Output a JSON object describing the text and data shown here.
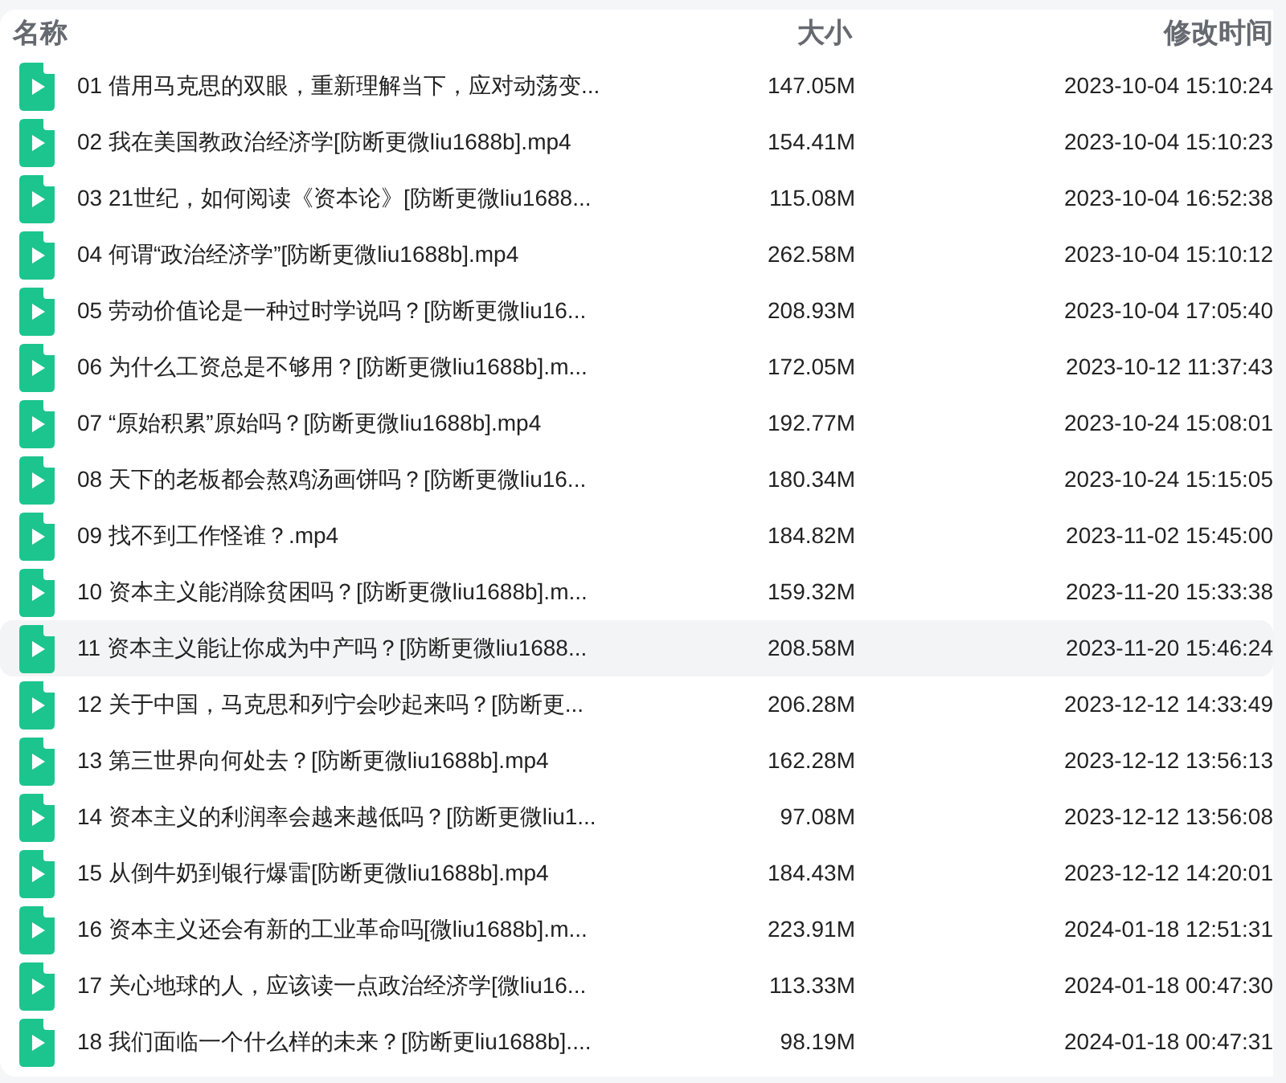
{
  "columns": [
    "名称",
    "大小",
    "修改时间"
  ],
  "files": [
    {
      "name": "01 借用马克思的双眼，重新理解当下，应对动荡变...",
      "size": "147.05M",
      "modified": "2023-10-04 15:10:24",
      "selected": false
    },
    {
      "name": "02 我在美国教政治经济学[防断更微liu1688b].mp4",
      "size": "154.41M",
      "modified": "2023-10-04 15:10:23",
      "selected": false
    },
    {
      "name": "03 21世纪，如何阅读《资本论》[防断更微liu1688...",
      "size": "115.08M",
      "modified": "2023-10-04 16:52:38",
      "selected": false
    },
    {
      "name": "04 何谓“政治经济学”[防断更微liu1688b].mp4",
      "size": "262.58M",
      "modified": "2023-10-04 15:10:12",
      "selected": false
    },
    {
      "name": "05 劳动价值论是一种过时学说吗？[防断更微liu16...",
      "size": "208.93M",
      "modified": "2023-10-04 17:05:40",
      "selected": false
    },
    {
      "name": "06 为什么工资总是不够用？[防断更微liu1688b].m...",
      "size": "172.05M",
      "modified": "2023-10-12 11:37:43",
      "selected": false
    },
    {
      "name": "07 “原始积累”原始吗？[防断更微liu1688b].mp4",
      "size": "192.77M",
      "modified": "2023-10-24 15:08:01",
      "selected": false
    },
    {
      "name": "08 天下的老板都会熬鸡汤画饼吗？[防断更微liu16...",
      "size": "180.34M",
      "modified": "2023-10-24 15:15:05",
      "selected": false
    },
    {
      "name": "09 找不到工作怪谁？.mp4",
      "size": "184.82M",
      "modified": "2023-11-02 15:45:00",
      "selected": false
    },
    {
      "name": "10 资本主义能消除贫困吗？[防断更微liu1688b].m...",
      "size": "159.32M",
      "modified": "2023-11-20 15:33:38",
      "selected": false
    },
    {
      "name": "11 资本主义能让你成为中产吗？[防断更微liu1688...",
      "size": "208.58M",
      "modified": "2023-11-20 15:46:24",
      "selected": true
    },
    {
      "name": "12 关于中国，马克思和列宁会吵起来吗？[防断更...",
      "size": "206.28M",
      "modified": "2023-12-12 14:33:49",
      "selected": false
    },
    {
      "name": "13 第三世界向何处去？[防断更微liu1688b].mp4",
      "size": "162.28M",
      "modified": "2023-12-12 13:56:13",
      "selected": false
    },
    {
      "name": "14 资本主义的利润率会越来越低吗？[防断更微liu1...",
      "size": "97.08M",
      "modified": "2023-12-12 13:56:08",
      "selected": false
    },
    {
      "name": "15 从倒牛奶到银行爆雷[防断更微liu1688b].mp4",
      "size": "184.43M",
      "modified": "2023-12-12 14:20:01",
      "selected": false
    },
    {
      "name": "16 资本主义还会有新的工业革命吗[微liu1688b].m...",
      "size": "223.91M",
      "modified": "2024-01-18 12:51:31",
      "selected": false
    },
    {
      "name": "17 关心地球的人，应该读一点政治经济学[微liu16...",
      "size": "113.33M",
      "modified": "2024-01-18 00:47:30",
      "selected": false
    },
    {
      "name": "18 我们面临一个什么样的未来？[防断更liu1688b]....",
      "size": "98.19M",
      "modified": "2024-01-18 00:47:31",
      "selected": false
    }
  ]
}
